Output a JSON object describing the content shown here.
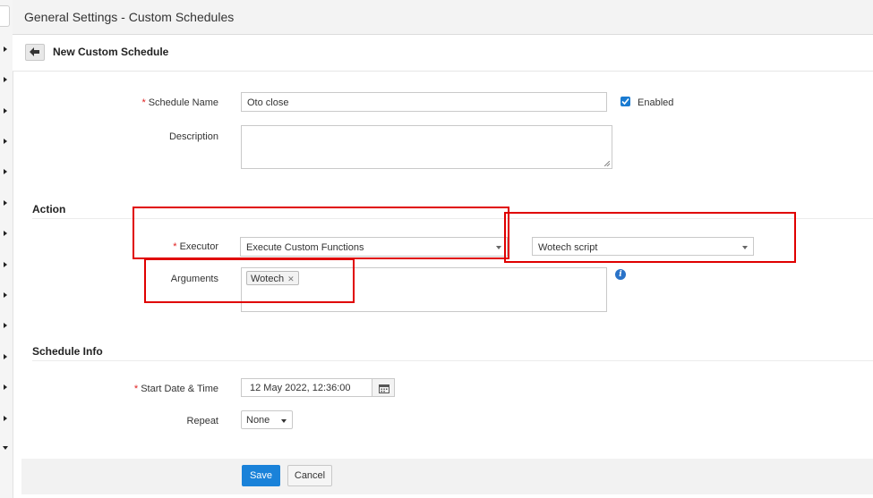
{
  "header": {
    "title": "General Settings - Custom Schedules"
  },
  "subheader": {
    "title": "New Custom Schedule"
  },
  "form": {
    "schedule_name_label": "Schedule Name",
    "schedule_name_value": "Oto close",
    "enabled_label": "Enabled",
    "enabled_checked": true,
    "description_label": "Description",
    "description_value": ""
  },
  "action": {
    "section_title": "Action",
    "executor_label": "Executor",
    "executor_value": "Execute Custom Functions",
    "function_value": "Wotech script",
    "arguments_label": "Arguments",
    "argument_tags": [
      "Wotech"
    ]
  },
  "schedule_info": {
    "section_title": "Schedule Info",
    "start_label": "Start Date & Time",
    "start_value": "12 May 2022, 12:36:00",
    "repeat_label": "Repeat",
    "repeat_value": "None"
  },
  "footer": {
    "save_label": "Save",
    "cancel_label": "Cancel"
  },
  "colors": {
    "primary": "#1a82d9",
    "highlight": "#e00000",
    "required": "#e02020"
  },
  "icons": {
    "back": "arrow-left-icon",
    "checkbox": "check-icon",
    "info": "info-icon",
    "calendar": "calendar-icon",
    "tag_remove": "close-icon"
  }
}
